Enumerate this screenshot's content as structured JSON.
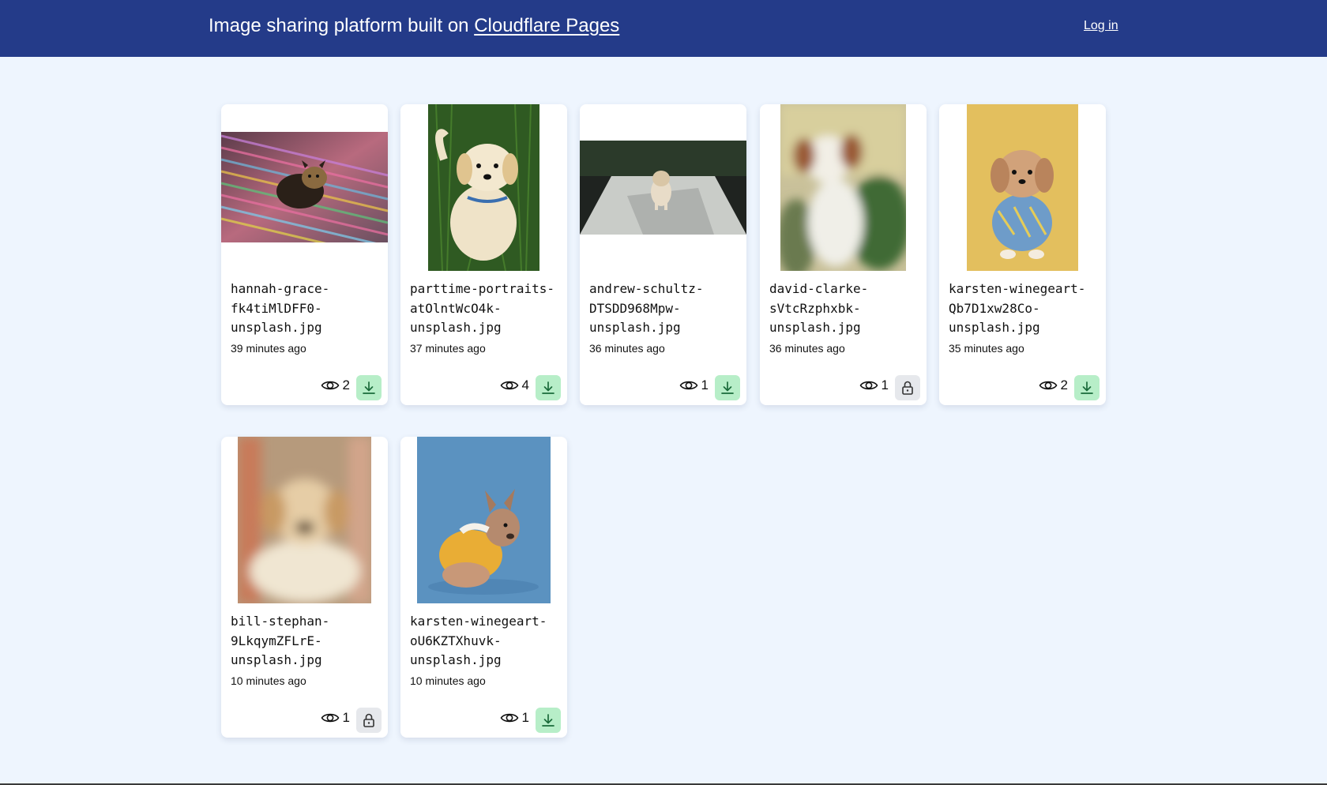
{
  "header": {
    "title_prefix": "Image sharing platform built on ",
    "title_link": "Cloudflare Pages",
    "login_label": "Log in"
  },
  "colors": {
    "header_bg": "#243b89",
    "page_bg": "#eef5fe",
    "download_bg": "#b7eec8",
    "locked_bg": "#e6e8ec"
  },
  "images": [
    {
      "filename": "hannah-grace-\nfk4tiMlDFF0-\nunsplash.jpg",
      "time": "39 minutes ago",
      "views": "2",
      "action": "download",
      "action_icon": "download-icon",
      "photo": "yorkshire-puppy-on-rug"
    },
    {
      "filename": "parttime-portraits-\natOlntWcO4k-\nunsplash.jpg",
      "time": "37 minutes ago",
      "views": "4",
      "action": "download",
      "action_icon": "download-icon",
      "photo": "golden-puppy-on-grass"
    },
    {
      "filename": "andrew-schultz-\nDTSDD968Mpw-\nunsplash.jpg",
      "time": "36 minutes ago",
      "views": "1",
      "action": "download",
      "action_icon": "download-icon",
      "photo": "puppy-running-on-path"
    },
    {
      "filename": "david-clarke-\nsVtcRzphxbk-\nunsplash.jpg",
      "time": "36 minutes ago",
      "views": "1",
      "action": "locked",
      "action_icon": "lock-icon",
      "photo": "blurred-terrier"
    },
    {
      "filename": "karsten-winegeart-\nQb7D1xw28Co-\nunsplash.jpg",
      "time": "35 minutes ago",
      "views": "2",
      "action": "download",
      "action_icon": "download-icon",
      "photo": "dog-in-sweater-yellow-bg"
    },
    {
      "filename": "bill-stephan-\n9LkqymZFLrE-\nunsplash.jpg",
      "time": "10 minutes ago",
      "views": "1",
      "action": "locked",
      "action_icon": "lock-icon",
      "photo": "blurred-golden-puppy"
    },
    {
      "filename": "karsten-winegeart-\noU6KZTXhuvk-\nunsplash.jpg",
      "time": "10 minutes ago",
      "views": "1",
      "action": "download",
      "action_icon": "download-icon",
      "photo": "french-bulldog-blue-bg"
    }
  ]
}
